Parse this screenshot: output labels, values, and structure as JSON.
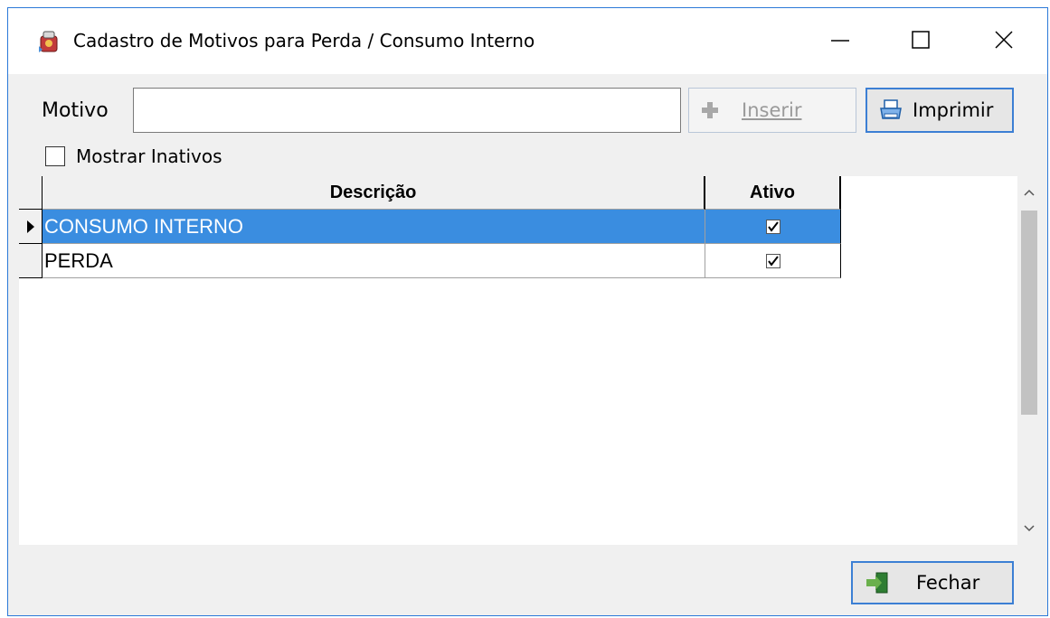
{
  "window": {
    "title": "Cadastro de Motivos para Perda / Consumo Interno",
    "accent_color": "#2b79d8"
  },
  "form": {
    "motivo_label": "Motivo",
    "motivo_value": "",
    "mostrar_inativos_label": "Mostrar Inativos",
    "mostrar_inativos_checked": false
  },
  "buttons": {
    "inserir": {
      "label": "Inserir",
      "icon": "plus-icon",
      "enabled": false
    },
    "imprimir": {
      "label": "Imprimir",
      "icon": "printer-icon"
    },
    "fechar": {
      "label": "Fechar",
      "icon": "exit-door-icon"
    }
  },
  "grid": {
    "columns": [
      "Descrição",
      "Ativo"
    ],
    "rows": [
      {
        "descricao": "CONSUMO INTERNO",
        "ativo": true,
        "selected": true
      },
      {
        "descricao": "PERDA",
        "ativo": true,
        "selected": false
      }
    ],
    "selection_color": "#3a8de0"
  }
}
